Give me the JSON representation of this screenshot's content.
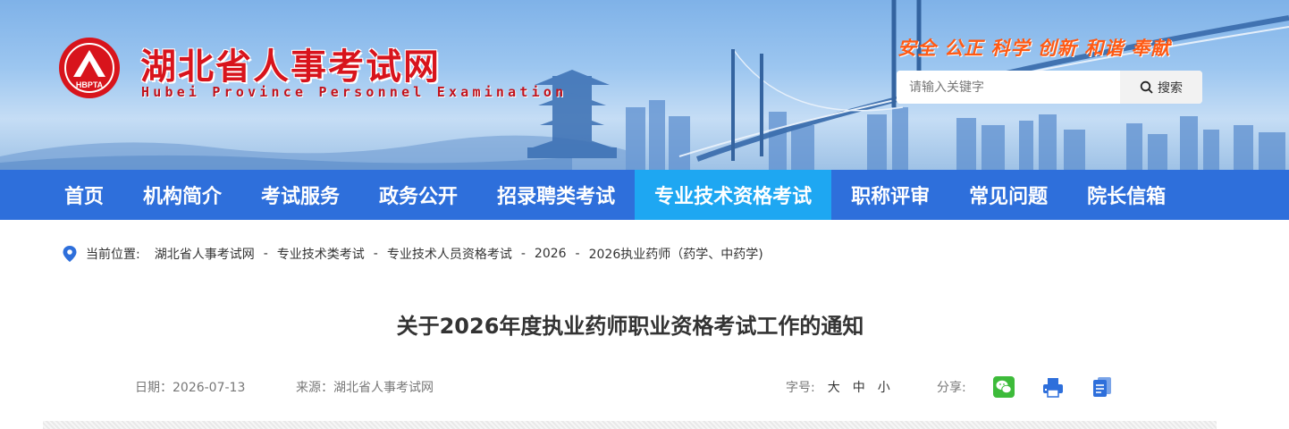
{
  "header": {
    "site_name": "湖北省人事考试网",
    "site_name_en": "Hubei Province Personnel Examination",
    "logo_text": "HBPTA",
    "slogan": "安全 公正 科学 创新 和谐 奉献",
    "search": {
      "placeholder": "请输入关键字",
      "button_label": "搜索"
    },
    "colors": {
      "brand_red": "#d8141c",
      "slogan_orange": "#ff5a14"
    }
  },
  "nav": {
    "items": [
      {
        "label": "首页"
      },
      {
        "label": "机构简介"
      },
      {
        "label": "考试服务"
      },
      {
        "label": "政务公开"
      },
      {
        "label": "招录聘类考试"
      },
      {
        "label": "专业技术资格考试",
        "active": true
      },
      {
        "label": "职称评审"
      },
      {
        "label": "常见问题"
      },
      {
        "label": "院长信箱"
      }
    ],
    "colors": {
      "bar": "#2e6fdb",
      "active": "#1ea7f2"
    }
  },
  "breadcrumb": {
    "label": "当前位置:",
    "items": [
      "湖北省人事考试网",
      "专业技术类考试",
      "专业技术人员资格考试",
      "2026",
      "2026执业药师（药学、中药学)"
    ],
    "separator": "-"
  },
  "article": {
    "title": "关于2026年度执业药师职业资格考试工作的通知",
    "date": "日期：2026-07-13",
    "source": "来源：湖北省人事考试网",
    "font_size_label": "字号:",
    "font_size_options": [
      "大",
      "中",
      "小"
    ],
    "share_label": "分享:",
    "share_icons": [
      "wechat-icon",
      "print-icon",
      "copy-icon"
    ]
  }
}
